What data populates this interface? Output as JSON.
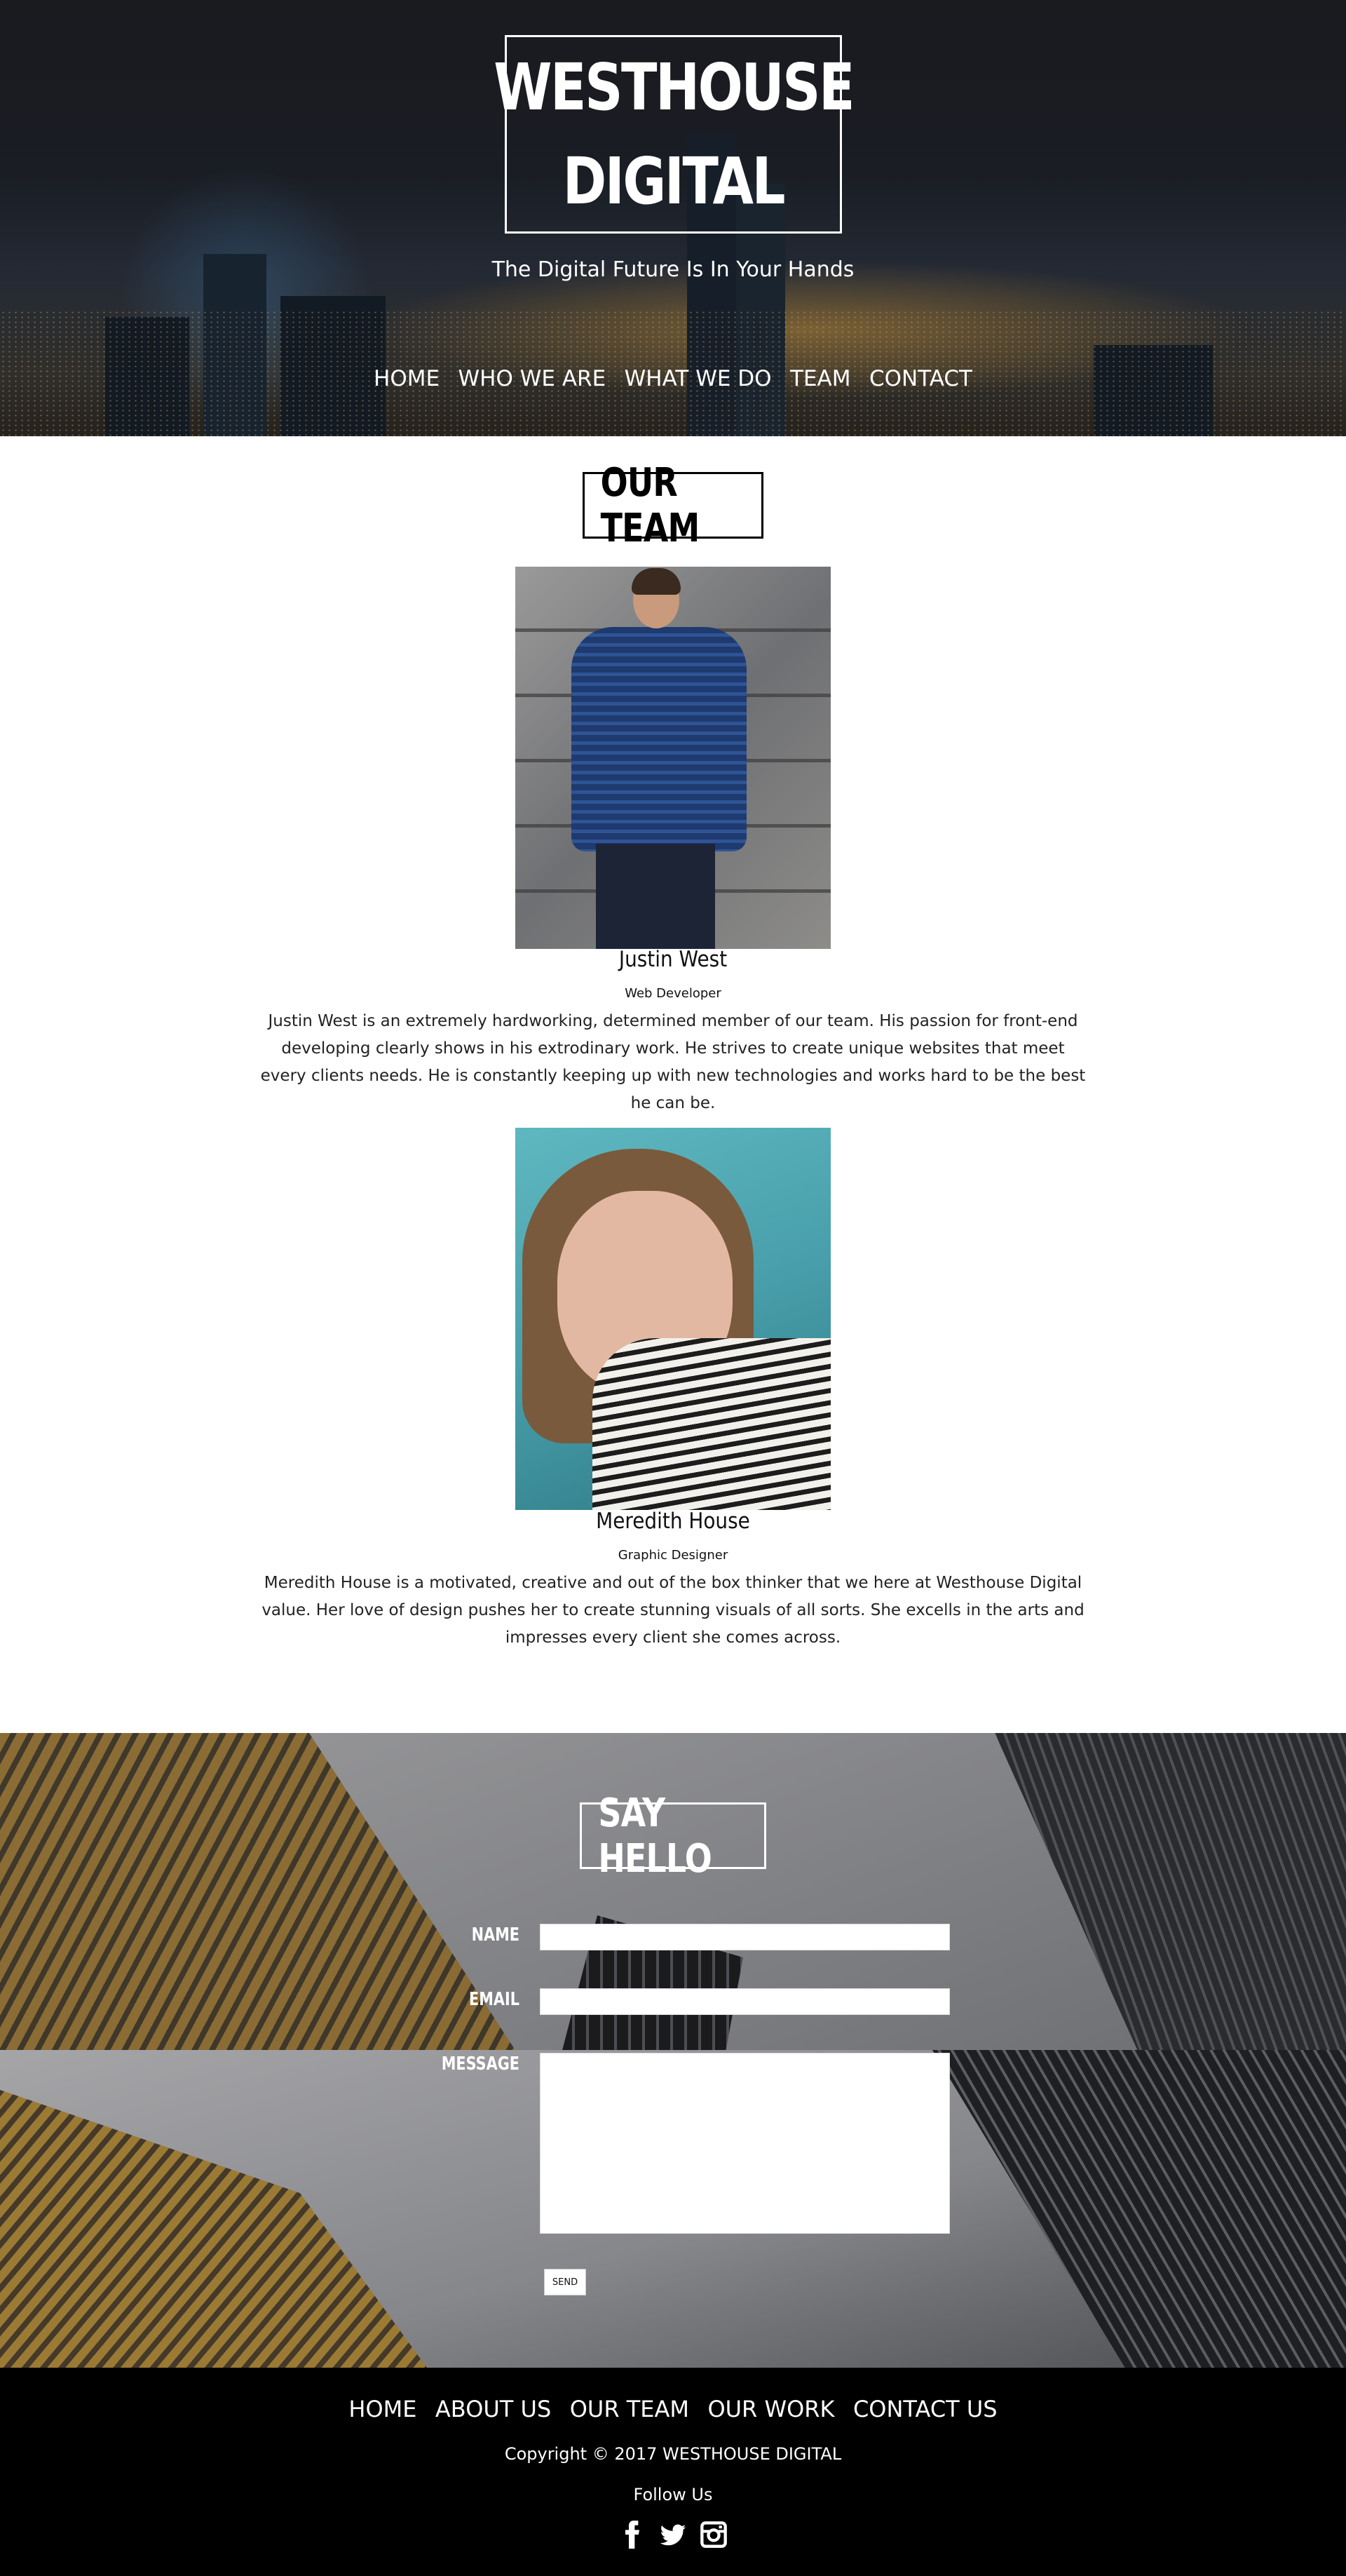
{
  "brand": {
    "line1": "WESTHOUSE",
    "line2": "DIGITAL",
    "tagline": "The Digital Future Is In Your Hands"
  },
  "top_nav": [
    "HOME",
    "WHO WE ARE",
    "WHAT WE DO",
    "TEAM",
    "CONTACT"
  ],
  "team": {
    "title": "OUR TEAM",
    "members": [
      {
        "name": "Justin West",
        "role": "Web Developer",
        "bio": "Justin West is an extremely hardworking, determined member of our team. His passion for front-end developing clearly shows in his extrodinary work. He strives to create unique websites that meet every clients needs. He is constantly keeping up with new technologies and works hard to be the best he can be."
      },
      {
        "name": "Meredith House",
        "role": "Graphic Designer",
        "bio": "Meredith House is a motivated, creative and out of the box thinker that we here at Westhouse Digital value. Her love of design pushes her to create stunning visuals of all sorts. She excells in the arts and impresses every client she comes across."
      }
    ]
  },
  "contact": {
    "title": "SAY HELLO",
    "name_label": "NAME",
    "email_label": "EMAIL",
    "message_label": "MESSAGE",
    "name_value": "",
    "email_value": "",
    "message_value": "",
    "send_label": "SEND"
  },
  "footer": {
    "nav": [
      "HOME",
      "ABOUT US",
      "OUR TEAM",
      "OUR WORK",
      "CONTACT US"
    ],
    "copyright": "Copyright © 2017 WESTHOUSE DIGITAL",
    "follow": "Follow Us",
    "social_icons": [
      "facebook-icon",
      "twitter-icon",
      "instagram-icon"
    ]
  }
}
